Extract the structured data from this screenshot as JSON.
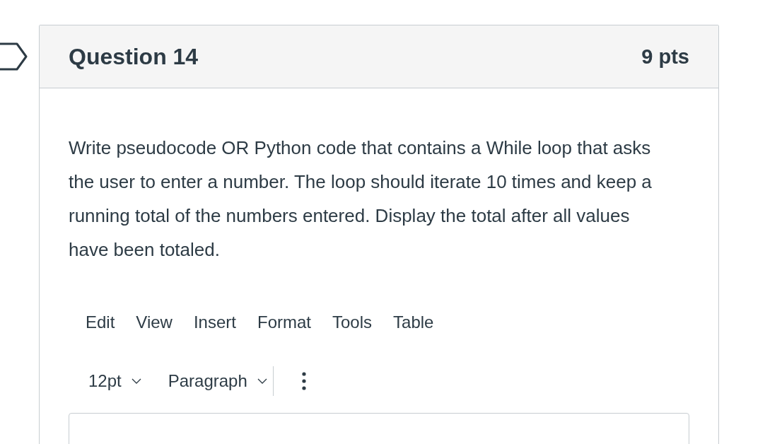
{
  "question": {
    "title": "Question 14",
    "points": "9 pts",
    "prompt": "Write pseudocode OR Python code that contains a While loop that asks the user to enter a number. The loop should iterate 10 times and keep a running total of the numbers entered. Display the total after all values have been totaled."
  },
  "editor": {
    "menu": [
      "Edit",
      "View",
      "Insert",
      "Format",
      "Tools",
      "Table"
    ],
    "toolbar": [
      {
        "kind": "dropdown",
        "label": "12pt"
      },
      {
        "kind": "dropdown",
        "label": "Paragraph"
      },
      {
        "kind": "more"
      }
    ]
  }
}
